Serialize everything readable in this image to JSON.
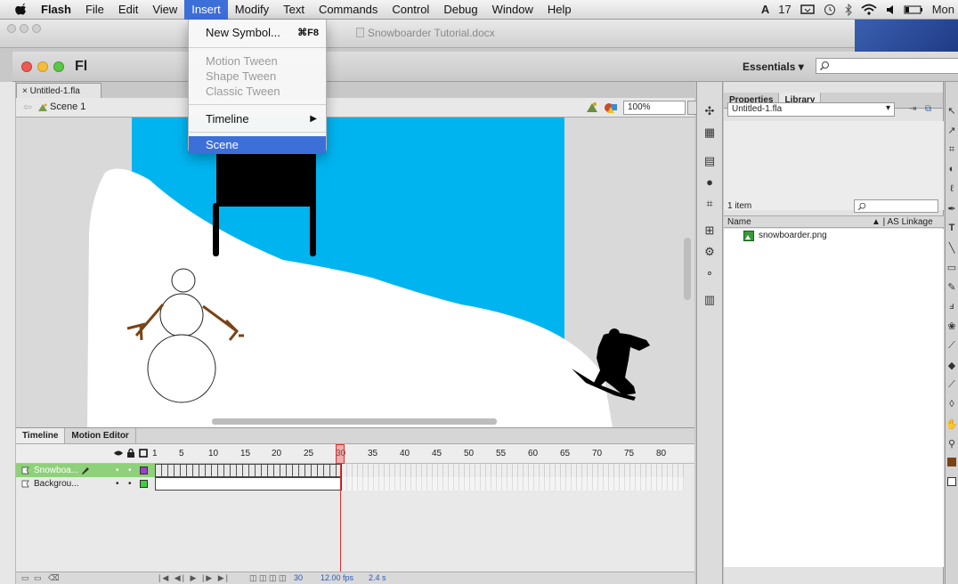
{
  "menubar": {
    "app": "Flash",
    "items": [
      "File",
      "Edit",
      "View",
      "Insert",
      "Modify",
      "Text",
      "Commands",
      "Control",
      "Debug",
      "Window",
      "Help"
    ],
    "active": "Insert",
    "status_num": "17",
    "clock": "Mon"
  },
  "doc_window": {
    "title": "Snowboarder Tutorial.docx"
  },
  "insert_menu": {
    "new_symbol": "New Symbol...",
    "new_symbol_shortcut": "⌘F8",
    "motion_tween": "Motion Tween",
    "shape_tween": "Shape Tween",
    "classic_tween": "Classic Tween",
    "timeline": "Timeline",
    "scene": "Scene"
  },
  "flash_window": {
    "logo": "Fl",
    "workspace": "Essentials",
    "workspace_arrow": "▾",
    "doc_tab": "× Untitled-1.fla",
    "scene": "Scene 1",
    "zoom": "100%"
  },
  "timeline": {
    "tabs": [
      "Timeline",
      "Motion Editor"
    ],
    "ruler": [
      "1",
      "5",
      "10",
      "15",
      "20",
      "25",
      "30",
      "35",
      "40",
      "45",
      "50",
      "55",
      "60",
      "65",
      "70",
      "75",
      "80"
    ],
    "playhead_frame": 30,
    "layers": [
      {
        "name": "Snowboa...",
        "selected": true,
        "color": "#9b3fd1"
      },
      {
        "name": "Backgrou...",
        "selected": false,
        "color": "#3ecf3e"
      }
    ],
    "status_frame": "30",
    "status_fps": "12.00 fps",
    "status_time": "2.4 s"
  },
  "library": {
    "tabs": [
      "Properties",
      "Library"
    ],
    "active_tab": "Library",
    "document": "Untitled-1.fla",
    "item_count": "1 item",
    "col_name": "Name",
    "col_linkage": "AS Linkage",
    "items": [
      "snowboarder.png"
    ]
  },
  "colors": {
    "sky": "#00b4f0",
    "accent": "#3d6fd9",
    "arms": "#7a4315",
    "timeline_selected": "#8fd07a"
  }
}
